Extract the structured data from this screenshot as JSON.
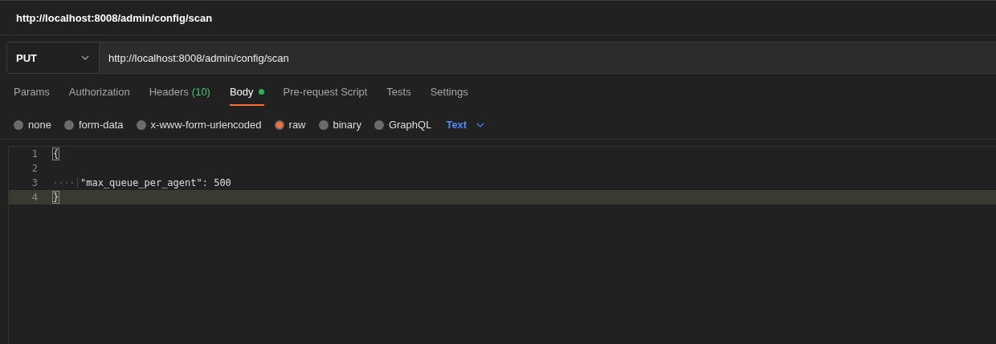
{
  "title": "http://localhost:8008/admin/config/scan",
  "request": {
    "method": "PUT",
    "url": "http://localhost:8008/admin/config/scan"
  },
  "tabs": [
    {
      "label": "Params",
      "selected": false
    },
    {
      "label": "Authorization",
      "selected": false
    },
    {
      "label": "Headers",
      "count": "(10)",
      "selected": false
    },
    {
      "label": "Body",
      "has_content": true,
      "selected": true
    },
    {
      "label": "Pre-request Script",
      "selected": false
    },
    {
      "label": "Tests",
      "selected": false
    },
    {
      "label": "Settings",
      "selected": false
    }
  ],
  "body_types": [
    {
      "label": "none",
      "selected": false
    },
    {
      "label": "form-data",
      "selected": false
    },
    {
      "label": "x-www-form-urlencoded",
      "selected": false
    },
    {
      "label": "raw",
      "selected": true
    },
    {
      "label": "binary",
      "selected": false
    },
    {
      "label": "GraphQL",
      "selected": false
    }
  ],
  "format": "Text",
  "editor": {
    "lines": [
      {
        "number": "1",
        "text": "{",
        "bracket_match": true,
        "current": false
      },
      {
        "number": "2",
        "current": false
      },
      {
        "number": "3",
        "text": "\"max_queue_per_agent\": 500",
        "indented": true,
        "bracket_match": false,
        "current": false
      },
      {
        "number": "4",
        "text": "}",
        "bracket_match": true,
        "current": true
      }
    ]
  }
}
